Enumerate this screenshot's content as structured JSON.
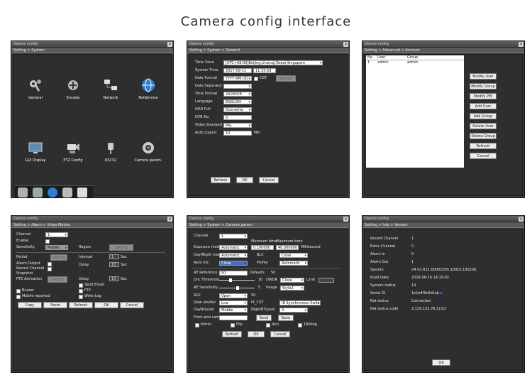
{
  "page_title": "Camera config interface",
  "window_title": "Device config",
  "panel1": {
    "breadcrumb": "Setting > System",
    "menu": [
      "General",
      "Encode",
      "Network",
      "NetService",
      "GUI Display",
      "PTZ Config",
      "RS232",
      "Camera param."
    ]
  },
  "panel2": {
    "breadcrumb": "Setting > System > General",
    "labels": [
      "Time Zone",
      "System Time",
      "Date Format",
      "Date Separator",
      "Time Format",
      "Language",
      "HDD Full",
      "DVR No.",
      "Video Standard",
      "Auto Logout"
    ],
    "values": [
      "[UTC+08:00]Beijing,Urumqi,Taipei,Singapore",
      "2017-09-11",
      "11:35:59",
      "YYYY MM DD",
      "DST",
      "Setting",
      ".",
      "24-HOUR",
      "ENGLISH",
      "Overwrite",
      "0",
      "PAL",
      "10",
      "Min"
    ],
    "buttons": [
      "Refresh",
      "OK",
      "Cancel"
    ]
  },
  "panel3": {
    "breadcrumb": "Setting > Advanced > Account",
    "columns": [
      "No.",
      "User",
      "Group"
    ],
    "rows": [
      [
        "1",
        "admin",
        "admin"
      ]
    ],
    "buttons": [
      "Modify User",
      "Modify Group",
      "Modify PW",
      "Add User",
      "Add Group",
      "Delete User",
      "Delete Group",
      "Refresh",
      "Cancel"
    ]
  },
  "panel4": {
    "breadcrumb": "Setting > Alarm > Video Motion",
    "labels": [
      "Channel",
      "Enable",
      "Sensitivity",
      "Region",
      "Period",
      "Interval",
      "Alarm Output",
      "Delay",
      "Record Channel",
      "Snapshot",
      "PTZ Activation",
      "Delay",
      "Send Email",
      "FTP",
      "Buzzer",
      "Mobile reported",
      "Write Log"
    ],
    "values": [
      "1",
      "Middle",
      "Setting",
      "Setting",
      "1",
      "Sec",
      "10",
      "Sec",
      "Setting",
      "10",
      "Sec"
    ],
    "buttons": [
      "Copy",
      "Paste",
      "Refresh",
      "OK",
      "Cancel"
    ]
  },
  "panel5": {
    "breadcrumb": "Setting > System > Camera param.",
    "labels": [
      "Channel",
      "Minimum time",
      "Maximum time",
      "Exposure mode",
      "Day/Night mode",
      "BLC",
      "Auto Iris",
      "Profile",
      "AE Reference",
      "Defaults",
      "Dnc Threshold",
      "DWDR",
      "Limit",
      "AE Sensitivity",
      "Image",
      "AGC",
      "Slow shutter",
      "DayNtLevel",
      "Front-end cam"
    ],
    "values": [
      "1",
      "Automatic",
      "0.100000",
      "40.000000",
      "Millisecond",
      "Automatic",
      "Close",
      "Close",
      "Automatic",
      "50",
      "50",
      "30",
      "Close",
      "5",
      "Style2",
      "Open",
      "50",
      "Low",
      "IR_CUT",
      "IR Synchronous Switc",
      "Middle",
      "NightNTLevel",
      "3",
      "Send",
      "Save"
    ],
    "checks": [
      "Mirror",
      "Flip",
      "Anti",
      "180deg"
    ],
    "buttons": [
      "Refresh",
      "OK",
      "Cancel"
    ]
  },
  "panel6": {
    "breadcrumb": "Setting > Info > Version",
    "labels": [
      "Record Channel",
      "Extra Channel",
      "Alarm In",
      "Alarm Out",
      "System",
      "Build Date",
      "System status",
      "Serial ID",
      "Nat status",
      "Nat status code"
    ],
    "values": [
      "1",
      "0",
      "0",
      "1",
      "V4.02.R11.00001005.10010.130100.",
      "2016-06-16 14:19:02",
      "14",
      "1e1e4f9c9d1ab",
      "Connected",
      "2:120.132.78.111/1"
    ],
    "link": "▶▶",
    "buttons": [
      "OK"
    ]
  },
  "colors": {
    "accent": "#3a6fe0",
    "panel_bg": "#3a3a3a"
  }
}
